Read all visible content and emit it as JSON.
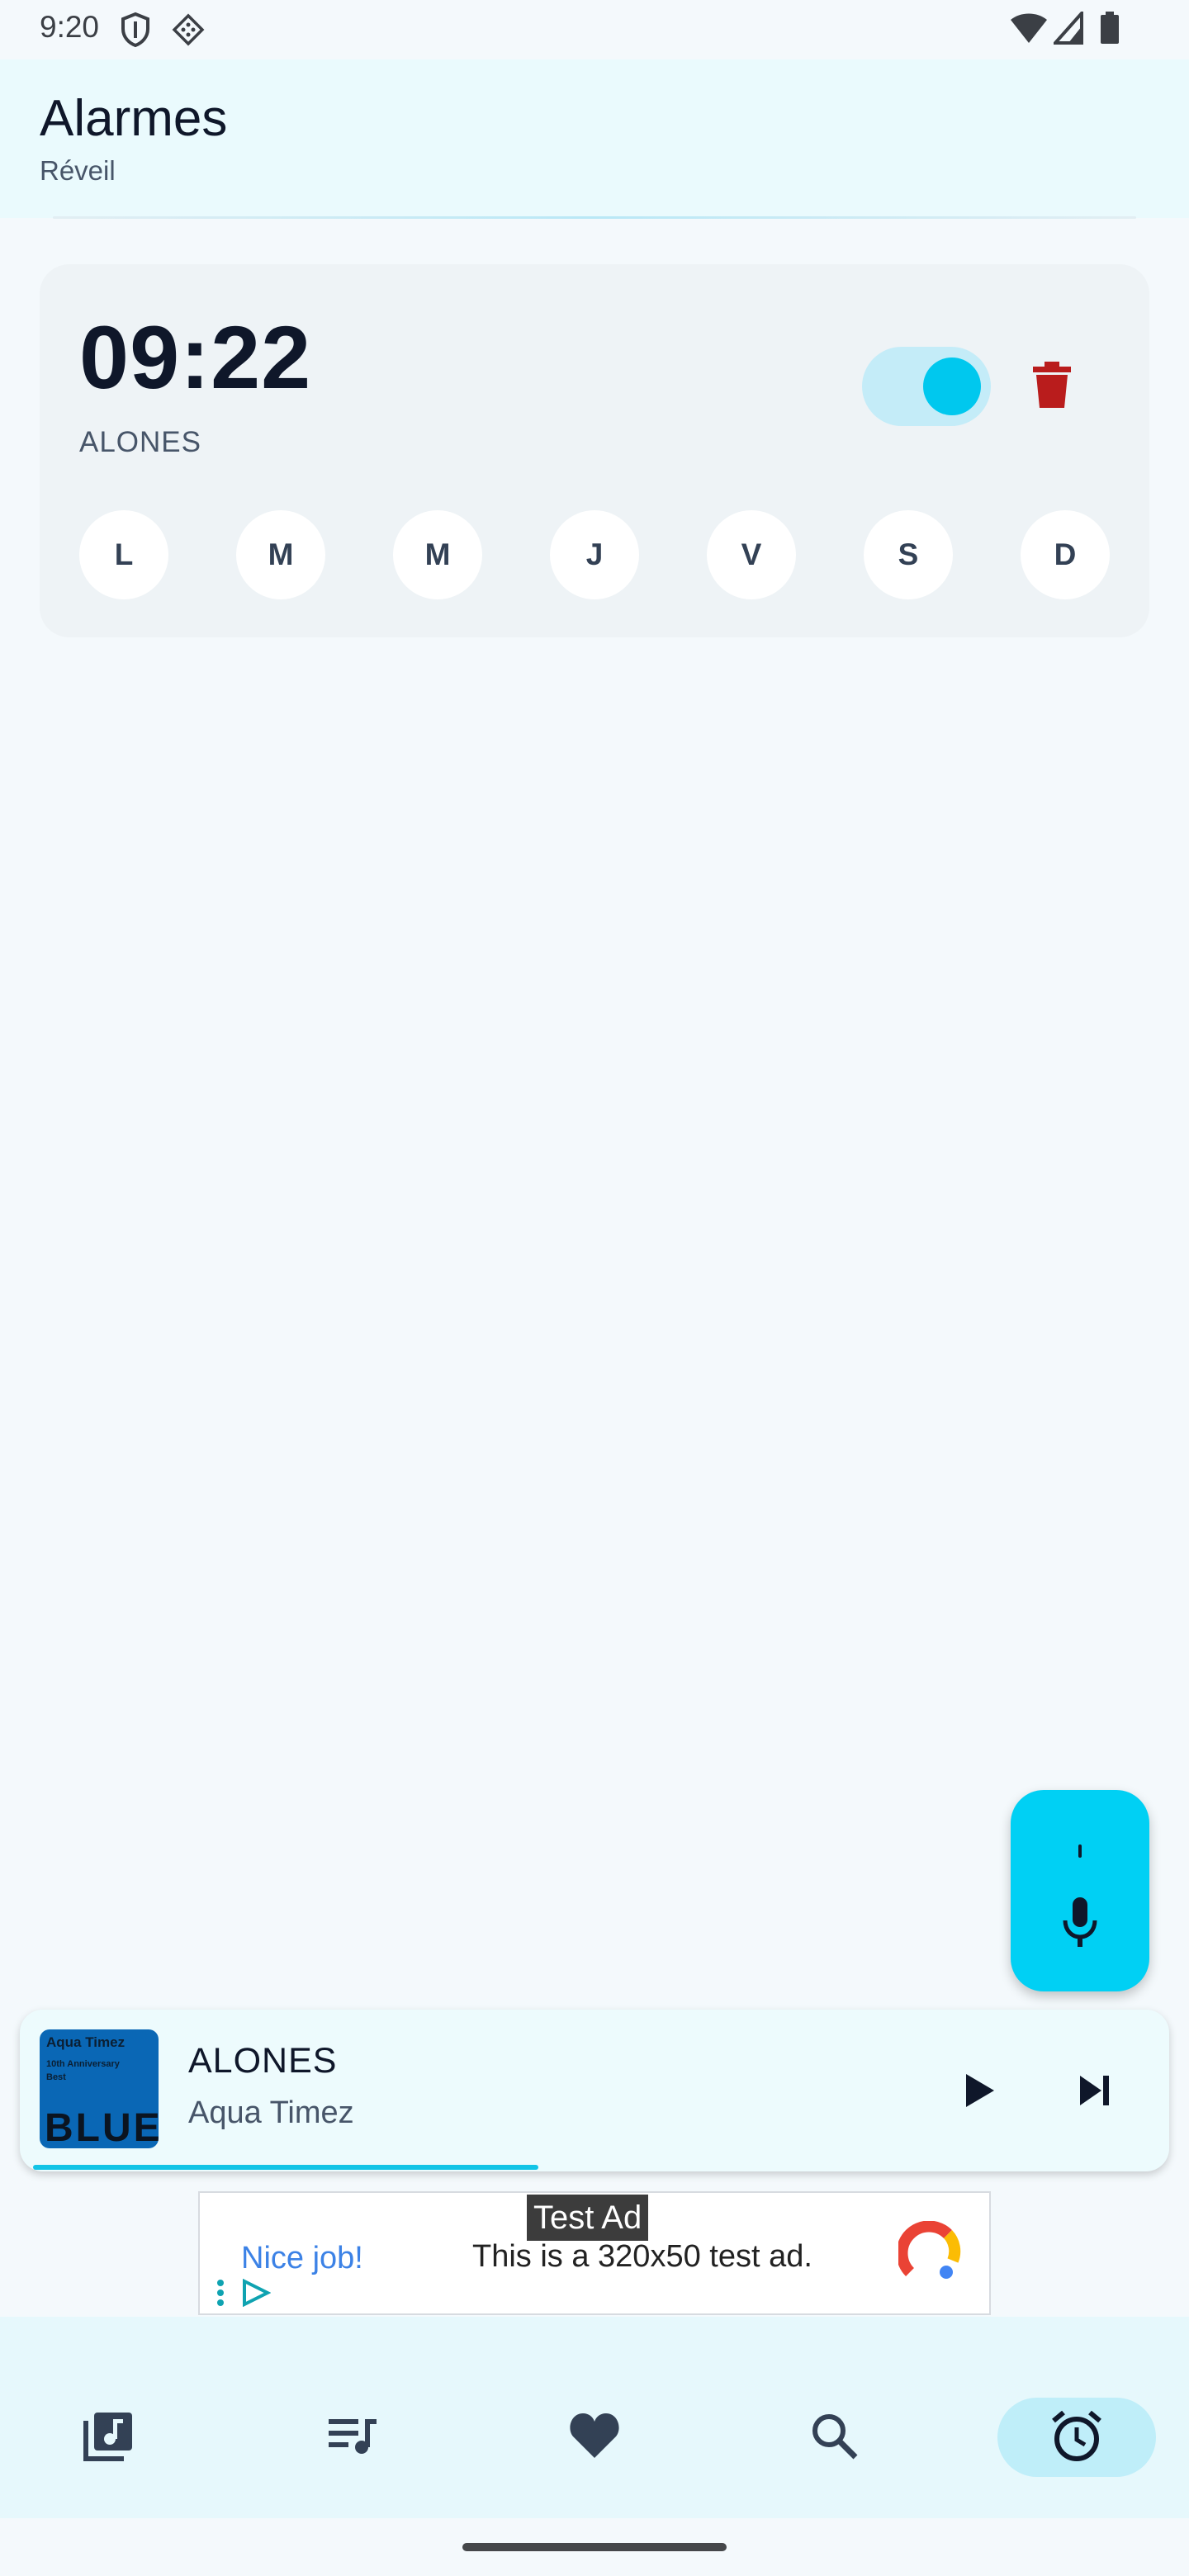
{
  "status_bar": {
    "time": "9:20",
    "icons": [
      "shield-icon",
      "sim-card-icon",
      "wifi-icon",
      "signal-icon",
      "battery-icon"
    ]
  },
  "header": {
    "title": "Alarmes",
    "subtitle": "Réveil"
  },
  "alarm": {
    "time": "09:22",
    "label": "ALONES",
    "enabled": true,
    "days": [
      "L",
      "M",
      "M",
      "J",
      "V",
      "S",
      "D"
    ]
  },
  "fab": {
    "icon": "microphone-icon"
  },
  "player": {
    "title": "ALONES",
    "artist": "Aqua Timez",
    "album_art": {
      "top_text": "Aqua Timez",
      "sub_text": "10th Anniversary Best",
      "big_text": "BLUE"
    },
    "progress": 0.44
  },
  "ad": {
    "tag": "Test Ad",
    "cta": "Nice job!",
    "text": "This is a 320x50 test ad."
  },
  "bottom_nav": {
    "items": [
      {
        "icon": "library-music-icon",
        "selected": false
      },
      {
        "icon": "queue-music-icon",
        "selected": false
      },
      {
        "icon": "heart-icon",
        "selected": false
      },
      {
        "icon": "search-icon",
        "selected": false
      },
      {
        "icon": "alarm-clock-icon",
        "selected": true
      }
    ]
  },
  "colors": {
    "accent": "#00d0f4",
    "delete": "#b91c1c",
    "background": "#f4f9fc"
  }
}
